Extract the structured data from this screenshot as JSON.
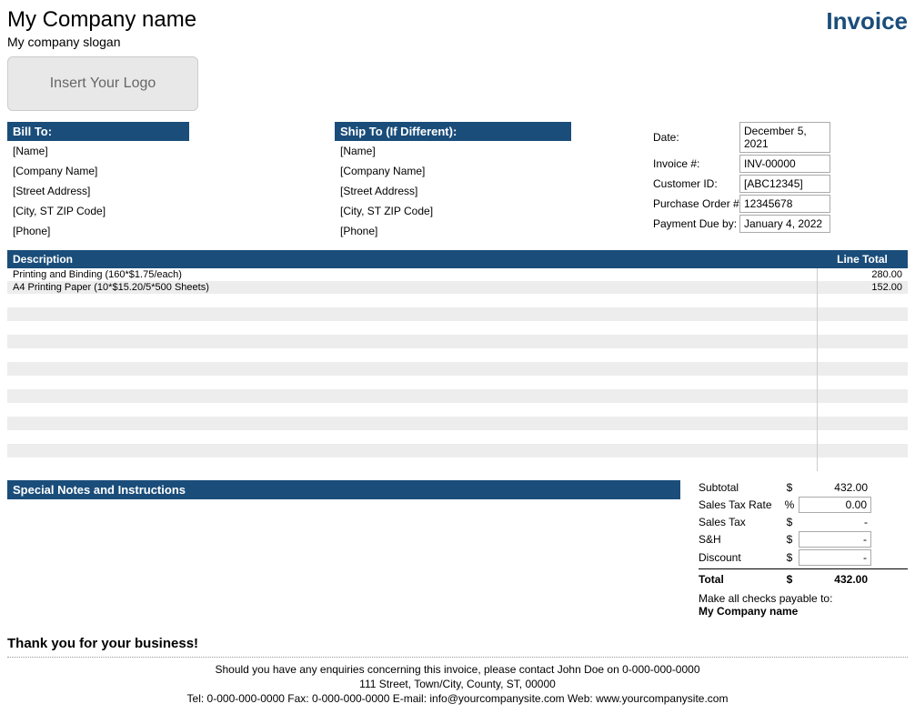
{
  "header": {
    "company_name": "My Company name",
    "slogan": "My company slogan",
    "logo_placeholder": "Insert Your Logo",
    "invoice_title": "Invoice"
  },
  "bill_to": {
    "header": "Bill To:",
    "name": "[Name]",
    "company": "[Company Name]",
    "street": "[Street Address]",
    "city": "[City, ST  ZIP Code]",
    "phone": "[Phone]"
  },
  "ship_to": {
    "header": "Ship To (If Different):",
    "name": "[Name]",
    "company": "[Company Name]",
    "street": "[Street Address]",
    "city": "[City, ST  ZIP Code]",
    "phone": "[Phone]"
  },
  "meta": {
    "date_label": "Date:",
    "date_value": "December 5, 2021",
    "invoice_num_label": "Invoice #:",
    "invoice_num_value": "INV-00000",
    "customer_id_label": "Customer ID:",
    "customer_id_value": "[ABC12345]",
    "po_label": "Purchase Order #",
    "po_value": "12345678",
    "due_label": "Payment Due by:",
    "due_value": "January 4, 2022"
  },
  "items": {
    "desc_header": "Description",
    "total_header": "Line Total",
    "rows": [
      {
        "desc": "Printing and Binding (160*$1.75/each)",
        "total": "280.00"
      },
      {
        "desc": "A4 Printing Paper (10*$15.20/5*500 Sheets)",
        "total": "152.00"
      }
    ]
  },
  "notes": {
    "header": "Special Notes and Instructions"
  },
  "totals": {
    "subtotal_label": "Subtotal",
    "subtotal_value": "432.00",
    "tax_rate_label": "Sales Tax Rate",
    "tax_rate_value": "0.00",
    "tax_label": "Sales Tax",
    "tax_value": "-",
    "sh_label": "S&H",
    "sh_value": "-",
    "discount_label": "Discount",
    "discount_value": "-",
    "total_label": "Total",
    "total_value": "432.00",
    "currency": "$",
    "percent": "%",
    "payable_text": "Make all checks payable to:",
    "payable_name": "My Company name"
  },
  "footer": {
    "thank_you": "Thank you for your business!",
    "contact": "Should you have any enquiries concerning this invoice, please contact John Doe on 0-000-000-0000",
    "address": "111 Street, Town/City, County, ST, 00000",
    "details": "Tel: 0-000-000-0000 Fax: 0-000-000-0000 E-mail: info@yourcompanysite.com Web: www.yourcompanysite.com"
  }
}
